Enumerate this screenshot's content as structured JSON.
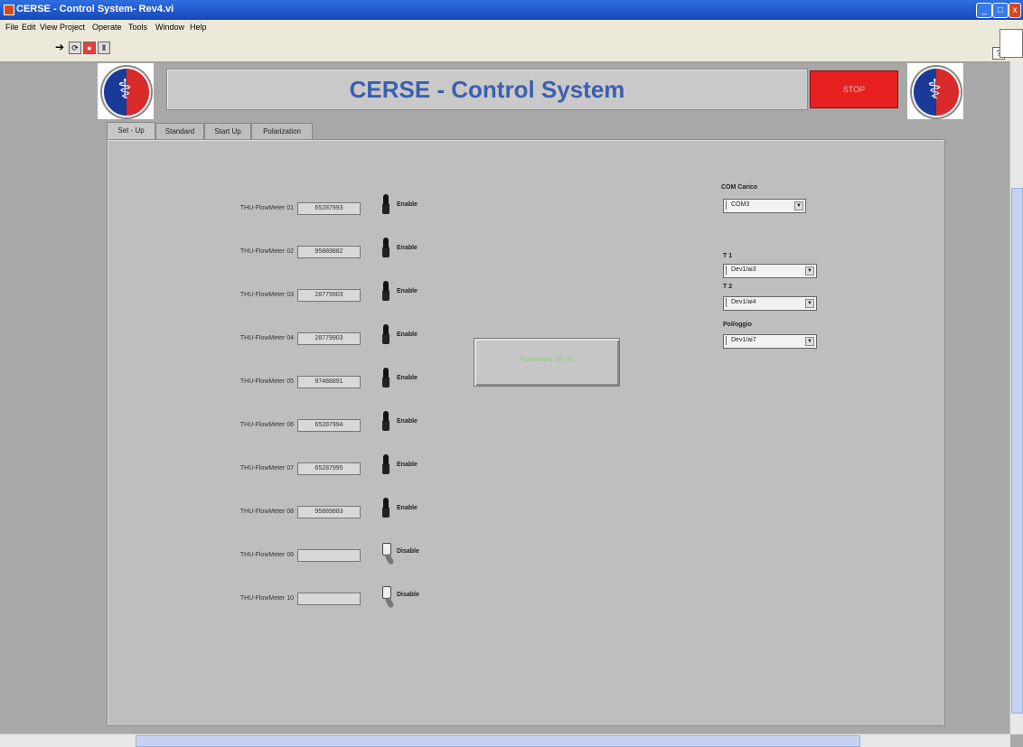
{
  "window": {
    "title": "CERSE - Control System- Rev4.vi",
    "buttons": [
      "_",
      "□",
      "x"
    ]
  },
  "menu": [
    "File",
    "Edit",
    "View",
    "Project",
    "Operate",
    "Tools",
    "Window",
    "Help"
  ],
  "toolbar": {
    "buttons": [
      "run-arrow",
      "run-continuous",
      "abort",
      "pause"
    ],
    "help": "?"
  },
  "header": {
    "title": "CERSE - Control System",
    "stop_label": "STOP"
  },
  "tabs": [
    {
      "label": "Set - Up",
      "active": true
    },
    {
      "label": "Standard",
      "active": false
    },
    {
      "label": "Start Up",
      "active": false
    },
    {
      "label": "Polarization",
      "active": false
    }
  ],
  "flowmeters": [
    {
      "label": "THU-FlowMeter 01",
      "value": "65287993",
      "state": "Enable"
    },
    {
      "label": "THU-FlowMeter 02",
      "value": "95889882",
      "state": "Enable"
    },
    {
      "label": "THU-FlowMeter 03",
      "value": "28779903",
      "state": "Enable"
    },
    {
      "label": "THU-FlowMeter 04",
      "value": "28779903",
      "state": "Enable"
    },
    {
      "label": "THU-FlowMeter 05",
      "value": "97488891",
      "state": "Enable"
    },
    {
      "label": "THU-FlowMeter 06",
      "value": "65287994",
      "state": "Enable"
    },
    {
      "label": "THU-FlowMeter 07",
      "value": "65287995",
      "state": "Enable"
    },
    {
      "label": "THU-FlowMeter 08",
      "value": "95889883",
      "state": "Enable"
    },
    {
      "label": "THU-FlowMeter 09",
      "value": "",
      "state": "Disable"
    },
    {
      "label": "THU-FlowMeter 10",
      "value": "",
      "state": "Disable"
    }
  ],
  "center_button": {
    "label": "Flowmeters Set Up"
  },
  "controls": {
    "com_label": "COM Carico",
    "com_value": "COM3",
    "t1_label": "T 1",
    "t1_value": "Dev1/ai3",
    "t2_label": "T 2",
    "t2_value": "Dev1/ai4",
    "pol_label": "Pol/oggio",
    "pol_value": "Dev1/ai7"
  },
  "colors": {
    "title": "#3b5fb0",
    "stop": "#e82020",
    "panel": "#bebebe"
  }
}
